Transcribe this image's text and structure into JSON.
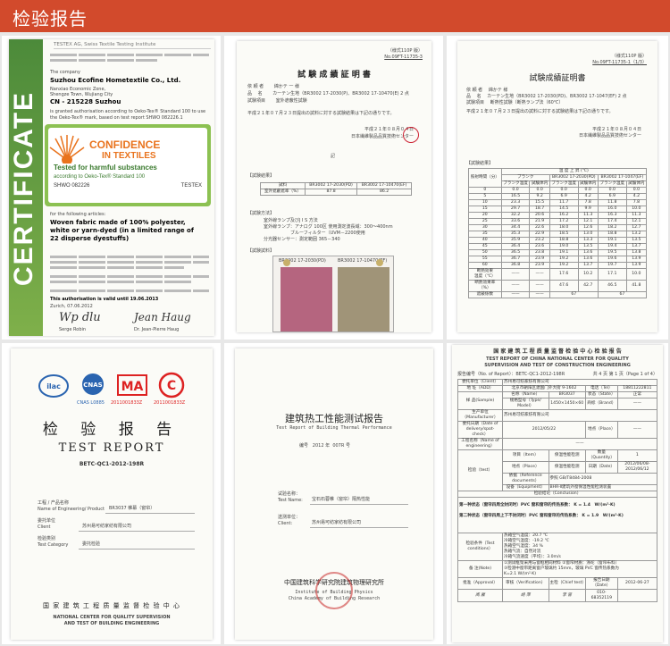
{
  "header": {
    "title": "检验报告"
  },
  "colors": {
    "header_bg": "#d24a2c",
    "cert_green": "#4c8a3a",
    "confidence_orange": "#e9731d"
  },
  "cert": {
    "band_text": "CERTIFICATE",
    "lab": "TESTEX AG, Swiss Textile Testing Institute",
    "company_label": "The company",
    "company": "Suzhou Ecofine Hometextile Co., Ltd.",
    "addr1": "Nanxiao Economic Zone,",
    "addr2": "Shengze Town, Wujiang City",
    "addr3": "CN - 215228 Suzhou",
    "granted": "is granted authorisation according to Oeko-Tex® Standard 100 to use the Oeko-Tex® mark, based on test report SHWO 082226.1",
    "conf1": "CONFIDENCE",
    "conf2": "IN TEXTILES",
    "conf3": "Tested for harmful substances",
    "conf4": "according to Oeko-Tex® Standard 100",
    "conf5": "SHWO 082226",
    "conf6": "TESTEX",
    "articles": "for the following articles:",
    "product": "Woven fabric made of 100% polyester, white or yarn-dyed (in a limited range of 22 disperse dyestuffs)",
    "valid": "This authorisation is valid until 19.06.2013",
    "date": "Zurich, 07.06.2012",
    "sig1": "Serge Robin",
    "sig2": "Dr. Jean-Pierre Haug"
  },
  "jp1": {
    "ref_top": "（様式110P 版）",
    "ref_no": "No.09FT-11735-3",
    "title": "試 験 成 績 証 明 書",
    "row1": "依 頼 者　　 綿かテ 一 様",
    "row2": "品　 名　　 カーテン生地（BR3002 17-2030(P)、BR3002 17-10470(E) 2 点",
    "row3": "試験項目　　 室外遮蔽性試験",
    "body": "平成２１年０７月２３日提出の試料に対する試験結果は下記の通りです。",
    "date": "平成２１年０８月０４日",
    "org": "日本繊維製品品質技術センター",
    "sub": "記",
    "sec1": "【試験結果】",
    "th1": "試料",
    "th2": "BR3002 17-2030(PD)",
    "th3": "BR3002 17-10470(EF)",
    "rlabel": "室外遮蔽遮率（%）",
    "v1": "87.8",
    "v2": "86.2",
    "sec2": "【試験方法】",
    "m1": "室外線ランプ及びJ I S 方法",
    "m2": "室外線ランプ：アナログ 100区 使用測定波長域：300～400nm",
    "m3": "ブルーフィルター（UVM－2200使用",
    "m4": "分光器センサー：測定範囲 365－340",
    "sec3": "【試験試料】",
    "s1": "BR3002 17-2030(PD)",
    "s2": "BR3002 17-10470(EF)"
  },
  "jp2": {
    "ref_top": "（様式110P 版）",
    "ref_no": "No.09FT-11735-1（1/3）",
    "title": "試験成績証明書",
    "row1": "依 頼 者　 綿かテ 様",
    "row2": "品　 名　 カーテン生地（BR3002 17-2030(PD)、BR3002 17-1047(EF) 2 点",
    "row3": "試験項目　 断熱性試験（断熱ランプ法（60℃）",
    "body": "平成２１年０７月２３日提出の試料に対する試験結果は下記の通りです。",
    "date": "平成２１年０８月０４日",
    "org": "日本繊維製品品質技術センター",
    "sec1": "【試験結果】",
    "h_time": "照射時間（分）",
    "h_temp": "温 度 上 昇 (℃)",
    "h_blank": "ブランク",
    "h_s1": "BR3002 17-2030(PD)",
    "h_s2": "BR3002 17-1047(EF)",
    "sub_a": "ブランク温度",
    "sub_b": "試験体内",
    "rows": [
      [
        "0",
        "0.0",
        "0.0",
        "0.0",
        "0.0",
        "0.0"
      ],
      [
        "5",
        "16.5",
        "9.2",
        "6.9",
        "4.2",
        "6.9",
        "4.2"
      ],
      [
        "10",
        "23.3",
        "15.5",
        "11.7",
        "7.8",
        "11.8",
        "7.8"
      ],
      [
        "15",
        "29.7",
        "18.7",
        "14.5",
        "9.9",
        "16.0",
        "10.0"
      ],
      [
        "20",
        "32.2",
        "20.6",
        "16.2",
        "11.3",
        "16.3",
        "11.3"
      ],
      [
        "25",
        "33.6",
        "21.9",
        "17.2",
        "12.1",
        "17.4",
        "12.1"
      ],
      [
        "30",
        "34.4",
        "22.6",
        "18.0",
        "12.6",
        "18.2",
        "12.7"
      ],
      [
        "35",
        "35.3",
        "22.9",
        "18.5",
        "13.0",
        "18.8",
        "13.2"
      ],
      [
        "40",
        "35.9",
        "23.2",
        "18.8",
        "13.3",
        "19.1",
        "13.5"
      ],
      [
        "45",
        "36.4",
        "23.6",
        "19.0",
        "13.5",
        "19.4",
        "13.7"
      ],
      [
        "50",
        "36.5",
        "23.8",
        "19.1",
        "13.6",
        "19.5",
        "13.8"
      ],
      [
        "55",
        "36.7",
        "23.9",
        "19.2",
        "13.6",
        "19.6",
        "13.9"
      ],
      [
        "60",
        "36.8",
        "23.9",
        "19.2",
        "13.7",
        "19.7",
        "13.9"
      ]
    ],
    "f1": "断熱効果",
    "f1a": "温度（℃）",
    "f1v": [
      "17.6",
      "10.2",
      "17.1",
      "10.0"
    ],
    "f2": "断熱効果率",
    "f2a": "（%）",
    "f2v": [
      "47.6",
      "42.7",
      "46.5",
      "41.8"
    ],
    "f3": "遮蔽係数",
    "f3v": [
      "67",
      "67"
    ]
  },
  "cn1": {
    "logos": [
      "ilac-MRA",
      "CNAS",
      "MA",
      "CAL"
    ],
    "logo_sub": [
      "CNAS L0885",
      "2011001833Z",
      "2011001833Z"
    ],
    "title": "检 验 报 告",
    "en_title": "TEST REPORT",
    "report_no": "BETC-QC1-2012-198R",
    "f1_label": "工程 / 产品名称",
    "f1_en": "Name of Engineering/ Product",
    "f1_val": "BR3037 帷幕（窗帘）",
    "f2_label": "委托单位",
    "f2_en": "Client",
    "f2_val": "苏州易可纺家纺有限公司",
    "f3_label": "检验类别",
    "f3_en": "Test Category",
    "f3_val": "委托检验",
    "center_cn": "国 家 建 筑 工 程 质 量 监 督 检 验 中 心",
    "center_en1": "NATIONAL CENTER FOR QUALITY SUPERVISION",
    "center_en2": "AND TEST OF BUILDING ENGINEERING"
  },
  "cn2": {
    "title": "建筑热工性能测试报告",
    "en_title": "Test Report of Building Thermal Performance",
    "no_label": "编号",
    "no_year": "2012",
    "no_num": "007R",
    "no_suffix": "号",
    "p_label": "试验名称：",
    "p_en": "Test Name:",
    "p_val": "宝石石蓉帷（窗帘）隔热性能",
    "c_label": "送测单位：",
    "c_en": "Client:",
    "c_val": "苏州易可纺家纺有限公司",
    "inst_cn": "中国建筑科学研究院建筑物理研究所",
    "inst_en1": "Institute of Building Physics",
    "inst_en2": "China Academy of Building Research"
  },
  "cn3": {
    "title_cn": "国 家 建 筑 工 程 质 量 监 督 检 验 中 心 检 验 报 告",
    "title_en1": "TEST REPORT OF CHINA NATIONAL CENTER FOR QUALITY",
    "title_en2": "SUPERVISION AND TEST OF CONSTRUCTION ENGINEERING",
    "no": "报告编号（No. of Report）：BETC-QC1-2012-198R",
    "page": "共 4 页 第 1 页（Page 1 of 4）",
    "rows": [
      [
        "委托单位（Client）",
        "苏州易可纺家纺有限公司"
      ],
      [
        "地 址（ADD）",
        "北京市朝阳区建国门外大街 9-1602",
        "电话（Tel）",
        "18811222811"
      ],
      [
        "样 品(Sample)",
        "名称（Name）",
        "BR3037",
        "状态（State）",
        "正常"
      ],
      [
        "",
        "规格型号（Type/ Model）",
        "1450×1450×60",
        "商标（Brand）",
        "——"
      ],
      [
        "生产单位（Manufacturer）",
        "苏州易可纺家纺有限公司"
      ],
      [
        "委托日期（Date of delivery/spot-check）",
        "2012/05/22",
        "地点（Place）",
        "——"
      ],
      [
        "工程名称（Name of engineering）",
        "——"
      ],
      [
        "检验（test）",
        "项目（Item）",
        "保温性能检测",
        "数量（Quantity）",
        "1"
      ],
      [
        "",
        "地点（Place）",
        "保温性能检测",
        "日期（Date）",
        "2012/06/08-2012/06/12"
      ],
      [
        "",
        "依据（Reference documents）",
        "参照 GB/T8484-2008"
      ],
      [
        "",
        "设备（Equipment）",
        "BHR-Ⅱ建筑外窗保温性能检测装置"
      ]
    ],
    "concl_h": "检验结论（Conclusion）",
    "c1": "第一种状态（窗帘四周全封闭时）PVC 窗和窗帘的传热系数：",
    "c1v": "K = 1.4　W/(m²·K)",
    "c2": "第二种状态（窗帘四周上下不封闭时）PVC 窗和窗帘的传热系数：",
    "c2v": "K = 1.9　W/(m²·K)",
    "cond": [
      "热箱空气温度：20.7 ℃",
      "冷箱空气温度：-19.2 ℃",
      "热箱空气湿度：34 %",
      "热箱气流：自然对流",
      "冷箱气流速度（平均）：3.0m/s"
    ],
    "cond_label": "检验条件（Test conditions）",
    "note_label": "备 注(Note)",
    "notes": [
      "①测试框架采用与窗框相同材料 ②窗帘材质：涤纶（窗帘布料）",
      "③检测中窗帘距离窗户玻璃约 15mm，玻璃 PVC 窗传热系数为",
      "K=2.1 W/(m²·K)"
    ],
    "sign_row": [
      "批准（Approval）",
      "审核（Verification）",
      "主检（Chief test）",
      "报告日期（Date）"
    ],
    "sign_vals": [
      "010-68352119",
      "2012-06-27"
    ]
  }
}
